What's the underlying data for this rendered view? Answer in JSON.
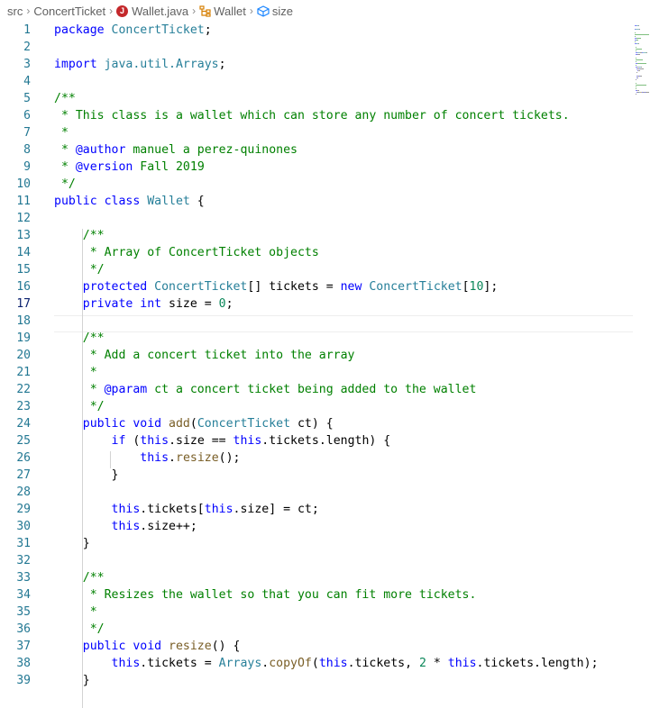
{
  "breadcrumb": {
    "items": [
      "src",
      "ConcertTicket",
      "Wallet.java",
      "Wallet",
      "size"
    ],
    "java_badge": "J"
  },
  "editor": {
    "active_line": 17,
    "lines": [
      {
        "n": "1",
        "tokens": [
          {
            "t": "package ",
            "c": "k"
          },
          {
            "t": "ConcertTicket",
            "c": "t"
          },
          {
            "t": ";",
            "c": "x"
          }
        ]
      },
      {
        "n": "2",
        "tokens": []
      },
      {
        "n": "3",
        "tokens": [
          {
            "t": "import ",
            "c": "k"
          },
          {
            "t": "java.util.Arrays",
            "c": "t"
          },
          {
            "t": ";",
            "c": "x"
          }
        ]
      },
      {
        "n": "4",
        "tokens": []
      },
      {
        "n": "5",
        "tokens": [
          {
            "t": "/**",
            "c": "c"
          }
        ]
      },
      {
        "n": "6",
        "tokens": [
          {
            "t": " * This class is a wallet which can store any number of concert tickets.",
            "c": "c"
          }
        ]
      },
      {
        "n": "7",
        "tokens": [
          {
            "t": " *",
            "c": "c"
          }
        ]
      },
      {
        "n": "8",
        "tokens": [
          {
            "t": " * ",
            "c": "c"
          },
          {
            "t": "@author",
            "c": "tg"
          },
          {
            "t": " manuel a perez-quinones",
            "c": "c"
          }
        ]
      },
      {
        "n": "9",
        "tokens": [
          {
            "t": " * ",
            "c": "c"
          },
          {
            "t": "@version",
            "c": "tg"
          },
          {
            "t": " Fall 2019",
            "c": "c"
          }
        ]
      },
      {
        "n": "10",
        "tokens": [
          {
            "t": " */",
            "c": "c"
          }
        ]
      },
      {
        "n": "11",
        "tokens": [
          {
            "t": "public ",
            "c": "k"
          },
          {
            "t": "class ",
            "c": "k"
          },
          {
            "t": "Wallet",
            "c": "t"
          },
          {
            "t": " {",
            "c": "x"
          }
        ]
      },
      {
        "n": "12",
        "tokens": []
      },
      {
        "n": "13",
        "tokens": [
          {
            "t": "    /**",
            "c": "c"
          }
        ]
      },
      {
        "n": "14",
        "tokens": [
          {
            "t": "     * Array of ConcertTicket objects",
            "c": "c"
          }
        ]
      },
      {
        "n": "15",
        "tokens": [
          {
            "t": "     */",
            "c": "c"
          }
        ]
      },
      {
        "n": "16",
        "tokens": [
          {
            "t": "    protected ",
            "c": "k"
          },
          {
            "t": "ConcertTicket",
            "c": "t"
          },
          {
            "t": "[] tickets = ",
            "c": "x"
          },
          {
            "t": "new ",
            "c": "k"
          },
          {
            "t": "ConcertTicket",
            "c": "t"
          },
          {
            "t": "[",
            "c": "x"
          },
          {
            "t": "10",
            "c": "n"
          },
          {
            "t": "];",
            "c": "x"
          }
        ]
      },
      {
        "n": "17",
        "tokens": [
          {
            "t": "    private ",
            "c": "k"
          },
          {
            "t": "int",
            "c": "k"
          },
          {
            "t": " size = ",
            "c": "x"
          },
          {
            "t": "0",
            "c": "n"
          },
          {
            "t": ";",
            "c": "x"
          }
        ]
      },
      {
        "n": "18",
        "tokens": []
      },
      {
        "n": "19",
        "tokens": [
          {
            "t": "    /**",
            "c": "c"
          }
        ]
      },
      {
        "n": "20",
        "tokens": [
          {
            "t": "     * Add a concert ticket into the array",
            "c": "c"
          }
        ]
      },
      {
        "n": "21",
        "tokens": [
          {
            "t": "     *",
            "c": "c"
          }
        ]
      },
      {
        "n": "22",
        "tokens": [
          {
            "t": "     * ",
            "c": "c"
          },
          {
            "t": "@param",
            "c": "tg"
          },
          {
            "t": " ct a concert ticket being added to the wallet",
            "c": "c"
          }
        ]
      },
      {
        "n": "23",
        "tokens": [
          {
            "t": "     */",
            "c": "c"
          }
        ]
      },
      {
        "n": "24",
        "tokens": [
          {
            "t": "    public ",
            "c": "k"
          },
          {
            "t": "void ",
            "c": "k"
          },
          {
            "t": "add",
            "c": "f"
          },
          {
            "t": "(",
            "c": "x"
          },
          {
            "t": "ConcertTicket",
            "c": "t"
          },
          {
            "t": " ct) {",
            "c": "x"
          }
        ]
      },
      {
        "n": "25",
        "tokens": [
          {
            "t": "        if ",
            "c": "k"
          },
          {
            "t": "(",
            "c": "x"
          },
          {
            "t": "this",
            "c": "k"
          },
          {
            "t": ".size == ",
            "c": "x"
          },
          {
            "t": "this",
            "c": "k"
          },
          {
            "t": ".tickets.length) {",
            "c": "x"
          }
        ]
      },
      {
        "n": "26",
        "tokens": [
          {
            "t": "            this",
            "c": "k"
          },
          {
            "t": ".",
            "c": "x"
          },
          {
            "t": "resize",
            "c": "f"
          },
          {
            "t": "();",
            "c": "x"
          }
        ]
      },
      {
        "n": "27",
        "tokens": [
          {
            "t": "        }",
            "c": "x"
          }
        ]
      },
      {
        "n": "28",
        "tokens": []
      },
      {
        "n": "29",
        "tokens": [
          {
            "t": "        this",
            "c": "k"
          },
          {
            "t": ".tickets[",
            "c": "x"
          },
          {
            "t": "this",
            "c": "k"
          },
          {
            "t": ".size] = ct;",
            "c": "x"
          }
        ]
      },
      {
        "n": "30",
        "tokens": [
          {
            "t": "        this",
            "c": "k"
          },
          {
            "t": ".size++;",
            "c": "x"
          }
        ]
      },
      {
        "n": "31",
        "tokens": [
          {
            "t": "    }",
            "c": "x"
          }
        ]
      },
      {
        "n": "32",
        "tokens": []
      },
      {
        "n": "33",
        "tokens": [
          {
            "t": "    /**",
            "c": "c"
          }
        ]
      },
      {
        "n": "34",
        "tokens": [
          {
            "t": "     * Resizes the wallet so that you can fit more tickets.",
            "c": "c"
          }
        ]
      },
      {
        "n": "35",
        "tokens": [
          {
            "t": "     *",
            "c": "c"
          }
        ]
      },
      {
        "n": "36",
        "tokens": [
          {
            "t": "     */",
            "c": "c"
          }
        ]
      },
      {
        "n": "37",
        "tokens": [
          {
            "t": "    public ",
            "c": "k"
          },
          {
            "t": "void ",
            "c": "k"
          },
          {
            "t": "resize",
            "c": "f"
          },
          {
            "t": "() {",
            "c": "x"
          }
        ]
      },
      {
        "n": "38",
        "tokens": [
          {
            "t": "        this",
            "c": "k"
          },
          {
            "t": ".tickets = ",
            "c": "x"
          },
          {
            "t": "Arrays",
            "c": "t"
          },
          {
            "t": ".",
            "c": "x"
          },
          {
            "t": "copyOf",
            "c": "f"
          },
          {
            "t": "(",
            "c": "x"
          },
          {
            "t": "this",
            "c": "k"
          },
          {
            "t": ".tickets, ",
            "c": "x"
          },
          {
            "t": "2",
            "c": "n"
          },
          {
            "t": " * ",
            "c": "x"
          },
          {
            "t": "this",
            "c": "k"
          },
          {
            "t": ".tickets.length);",
            "c": "x"
          }
        ]
      },
      {
        "n": "39",
        "tokens": [
          {
            "t": "    }",
            "c": "x"
          }
        ]
      }
    ]
  }
}
